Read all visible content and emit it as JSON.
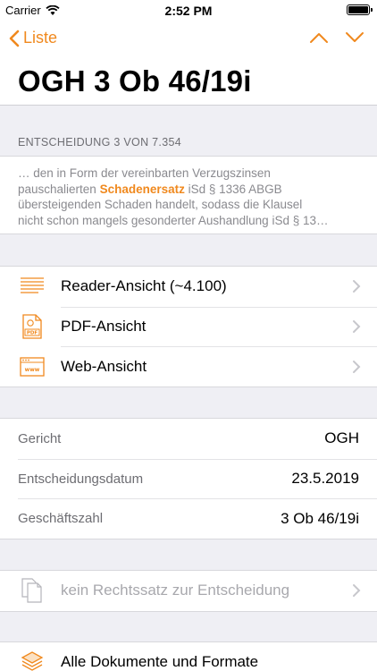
{
  "status_bar": {
    "carrier": "Carrier",
    "time": "2:52 PM"
  },
  "nav": {
    "back_label": "Liste",
    "title": "OGH 3 Ob 46/19i"
  },
  "section_header": "ENTSCHEIDUNG 3 VON 7.354",
  "snippet": {
    "line1": "… den in Form der vereinbarten Verzugszinsen",
    "line2_pre": "pauschalierten ",
    "line2_highlight": "Schadenersatz",
    "line2_post": " iSd § 1336 ABGB",
    "line3": "übersteigenden Schaden handelt, sodass die Klausel",
    "line4": "nicht schon mangels gesonderter Aushandlung iSd § 13…"
  },
  "views": [
    {
      "label": "Reader-Ansicht (~4.100)",
      "icon": "text-lines-icon"
    },
    {
      "label": "PDF-Ansicht",
      "icon": "pdf-icon"
    },
    {
      "label": "Web-Ansicht",
      "icon": "web-icon"
    }
  ],
  "details": [
    {
      "key": "Gericht",
      "value": "OGH"
    },
    {
      "key": "Entscheidungsdatum",
      "value": "23.5.2019"
    },
    {
      "key": "Geschäftszahl",
      "value": "3 Ob 46/19i"
    }
  ],
  "rechtssatz": {
    "label": "kein Rechtssatz zur Entscheidung",
    "icon": "documents-icon"
  },
  "all_docs": {
    "label": "Alle Dokumente und Formate",
    "icon": "stack-icon"
  },
  "colors": {
    "accent": "#f0891e",
    "background": "#efeff4",
    "secondary_text": "#6d6d72"
  }
}
